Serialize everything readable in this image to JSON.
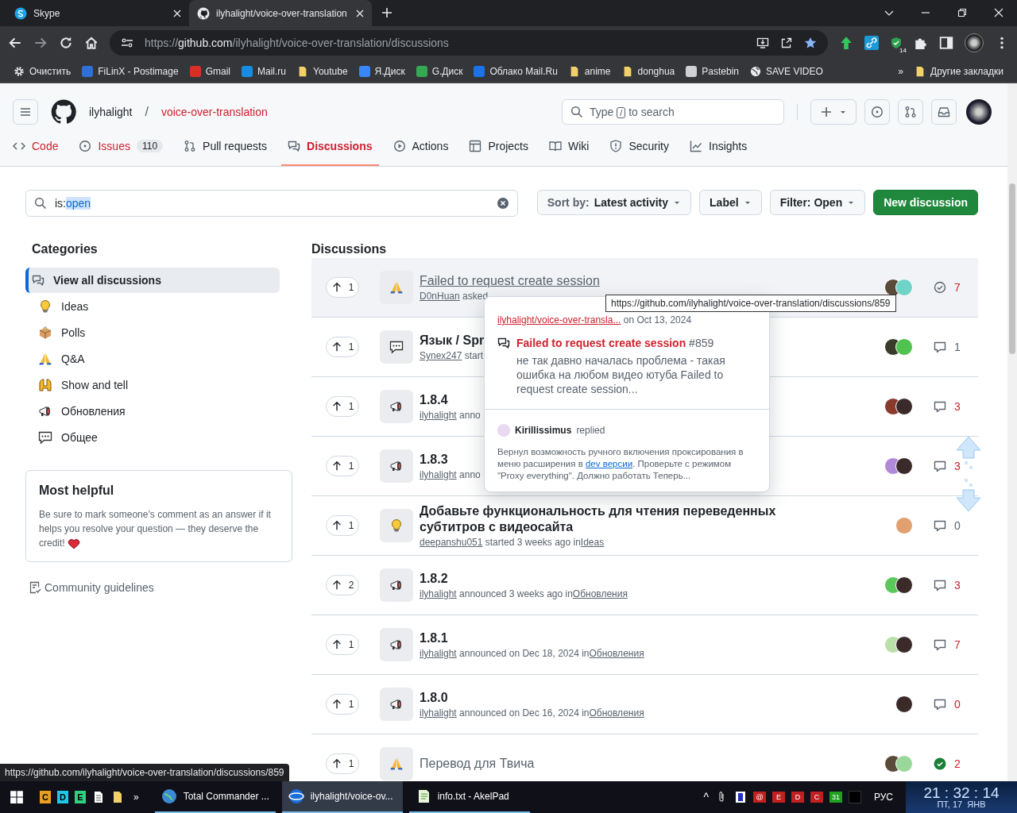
{
  "browser": {
    "tabs": [
      {
        "title": "Skype",
        "selected": false
      },
      {
        "title": "ilyhalight/voice-over-translation",
        "selected": true
      }
    ],
    "url": {
      "scheme": "https://",
      "host": "github.com",
      "path": "/ilyhalight/voice-over-translation/discussions"
    },
    "extension_badge": "14",
    "bookmarks": [
      {
        "label": "Очистить"
      },
      {
        "label": "FiLinX - Postimage"
      },
      {
        "label": "Gmail"
      },
      {
        "label": "Mail.ru"
      },
      {
        "label": "Youtube"
      },
      {
        "label": "Я.Диск"
      },
      {
        "label": "G.Диск"
      },
      {
        "label": "Облако Mail.Ru"
      },
      {
        "label": "anime"
      },
      {
        "label": "donghua"
      },
      {
        "label": "Pastebin"
      },
      {
        "label": "SAVE VIDEO"
      }
    ],
    "more_bookmarks": "»",
    "other_bookmarks": "Другие закладки"
  },
  "github": {
    "owner": "ilyhalight",
    "separator": "/",
    "repo": "voice-over-translation",
    "search": {
      "before": "Type",
      "key": "/",
      "after": "to search"
    },
    "nav": [
      {
        "label": "Code",
        "visited": true,
        "selected": false
      },
      {
        "label": "Issues",
        "visited": true,
        "selected": false,
        "count": "110"
      },
      {
        "label": "Pull requests",
        "visited": false,
        "selected": false
      },
      {
        "label": "Discussions",
        "visited": false,
        "selected": true
      },
      {
        "label": "Actions",
        "visited": false,
        "selected": false
      },
      {
        "label": "Projects",
        "visited": false,
        "selected": false
      },
      {
        "label": "Wiki",
        "visited": false,
        "selected": false
      },
      {
        "label": "Security",
        "visited": false,
        "selected": false
      },
      {
        "label": "Insights",
        "visited": false,
        "selected": false
      }
    ]
  },
  "filter": {
    "value_prefix": "is:",
    "value_selected": "open",
    "sort_label": "Sort by:",
    "sort_value": "Latest activity",
    "label_button": "Label",
    "filter_button": "Filter: Open",
    "new_button": "New discussion"
  },
  "sidebar": {
    "title": "Categories",
    "categories": [
      {
        "label": "View all discussions",
        "selected": true
      },
      {
        "label": "Ideas",
        "selected": false
      },
      {
        "label": "Polls",
        "selected": false
      },
      {
        "label": "Q&A",
        "selected": false
      },
      {
        "label": "Show and tell",
        "selected": false
      },
      {
        "label": "Обновления",
        "selected": false
      },
      {
        "label": "Общее",
        "selected": false
      }
    ],
    "helpful": {
      "title": "Most helpful",
      "text": "Be sure to mark someone’s comment as an answer if it helps you resolve your question — they deserve the credit!"
    },
    "guidelines": "Community guidelines"
  },
  "discussions": {
    "title": "Discussions",
    "rows": [
      {
        "votes": "1",
        "kind": "qa",
        "title": "Failed to request create session",
        "visited": true,
        "hovered": true,
        "author": "D0nHuan",
        "verb": "asked",
        "avatars": [
          {
            "color": "#5a4a3a"
          },
          {
            "color": "#6fd3c8"
          }
        ],
        "answered": false,
        "count": "7",
        "hot": true
      },
      {
        "votes": "1",
        "kind": "general",
        "title": "Язык / Spr",
        "visited": false,
        "hovered": false,
        "author": "Synex247",
        "verb": "start",
        "avatars": [
          {
            "color": "#3a3a2a"
          },
          {
            "color": "#4fc24f"
          }
        ],
        "answered": false,
        "count": "1",
        "hot": false
      },
      {
        "votes": "1",
        "kind": "announce",
        "title": "1.8.4",
        "visited": false,
        "hovered": false,
        "author": "ilyhalight",
        "verb": "anno",
        "avatars": [
          {
            "color": "#8a3a2a"
          },
          {
            "color": "#3a2a2a"
          }
        ],
        "answered": false,
        "count": "3",
        "hot": true
      },
      {
        "votes": "1",
        "kind": "announce",
        "title": "1.8.3",
        "visited": false,
        "hovered": false,
        "author": "ilyhalight",
        "verb": "anno",
        "avatars": [
          {
            "color": "#b08ad8"
          },
          {
            "color": "#3a2a2a"
          }
        ],
        "answered": false,
        "count": "3",
        "hot": true
      },
      {
        "votes": "1",
        "kind": "idea",
        "title": "Добавьте функциональность для чтения переведенных субтитров с видеосайта",
        "visited": false,
        "hovered": false,
        "author": "deepanshu051",
        "verb": "started 3 weeks ago in",
        "category": "Ideas",
        "avatars": [
          {
            "color": "#e0a070"
          }
        ],
        "answered": false,
        "count": "0",
        "hot": false
      },
      {
        "votes": "2",
        "kind": "announce",
        "title": "1.8.2",
        "visited": false,
        "hovered": false,
        "author": "ilyhalight",
        "verb": "announced 3 weeks ago in",
        "category": "Обновления",
        "avatars": [
          {
            "color": "#5cc85c"
          },
          {
            "color": "#3a2a2a"
          }
        ],
        "answered": false,
        "count": "3",
        "hot": true
      },
      {
        "votes": "1",
        "kind": "announce",
        "title": "1.8.1",
        "visited": false,
        "hovered": false,
        "author": "ilyhalight",
        "verb": "announced on Dec 18, 2024 in",
        "category": "Обновления",
        "avatars": [
          {
            "color": "#b8e0a8"
          },
          {
            "color": "#3a2a2a"
          }
        ],
        "answered": false,
        "count": "7",
        "hot": true
      },
      {
        "votes": "1",
        "kind": "announce",
        "title": "1.8.0",
        "visited": false,
        "hovered": false,
        "author": "ilyhalight",
        "verb": "announced on Dec 16, 2024 in",
        "category": "Обновления",
        "avatars": [
          {
            "color": "#3a2a2a"
          }
        ],
        "answered": false,
        "count": "0",
        "hot": true
      },
      {
        "votes": "1",
        "kind": "qa",
        "title": "Перевод для Твича",
        "visited": true,
        "hovered": false,
        "avatars": [
          {
            "color": "#5a4a3a"
          },
          {
            "color": "#9ad89a"
          }
        ],
        "answered": true,
        "count": "2",
        "hot": true
      }
    ]
  },
  "hovercard": {
    "repo": "ilyhalight/voice-over-transla...",
    "date": "on Oct 13, 2024",
    "title": "Failed to request create session",
    "number": "#859",
    "body": "не так давно началась проблема - такая ошибка на любом видео ютуба Failed to request create session...",
    "replier": "Kirillissimus",
    "replied": "replied",
    "reply_before": "Вернул возможность ручного включения проксирования в меню расширения в ",
    "reply_link": "dev версии",
    "reply_after": ". Проверьте с режимом \"Proxy everything\". Должно работать Теперь..."
  },
  "link_tooltip": "https://github.com/ilyhalight/voice-over-translation/discussions/859",
  "status_url": "https://github.com/ilyhalight/voice-over-translation/discussions/859",
  "taskbar": {
    "quick_launch": [
      {
        "label": "C",
        "color": "#e8a020"
      },
      {
        "label": "D",
        "color": "#20c8e8"
      },
      {
        "label": "E",
        "color": "#30d080"
      }
    ],
    "more": "»",
    "tasks": [
      {
        "label": "Total Commander ...",
        "selected": false
      },
      {
        "label": "ilyhalight/voice-ov...",
        "selected": true
      },
      {
        "label": "info.txt - AkelPad",
        "selected": false
      }
    ],
    "tray_caret": "^",
    "tray_icons": [
      {
        "label": "@",
        "color": "#c02020"
      },
      {
        "label": "E",
        "color": "#c02020"
      },
      {
        "label": "D",
        "color": "#c02020"
      },
      {
        "label": "C",
        "color": "#c02020"
      },
      {
        "label": "31",
        "color": "#20a020"
      }
    ],
    "language": "РУС",
    "clock": "21 : 32 : 14",
    "date": "ПТ, 17  ЯНВ"
  }
}
